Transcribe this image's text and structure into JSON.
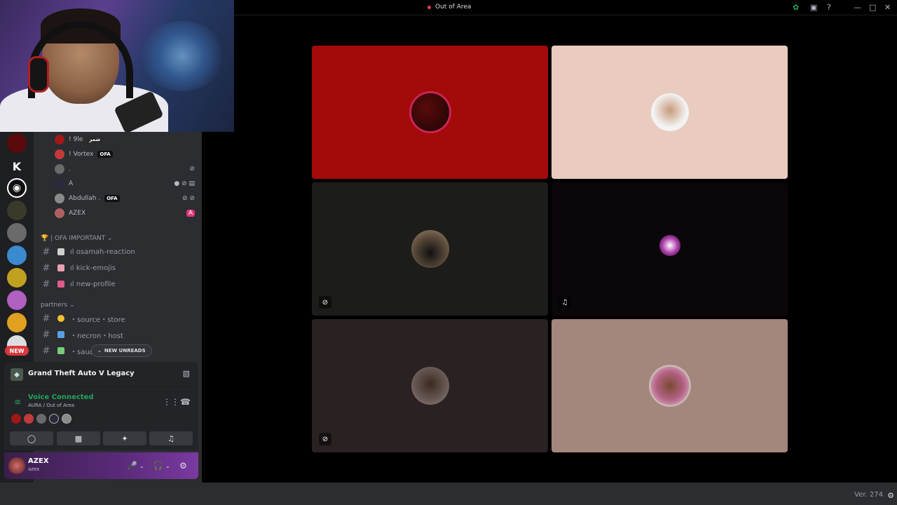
{
  "titlebar": {
    "channel_name": "Out of Area"
  },
  "rail": {
    "new_badge": "NEW"
  },
  "voice_members": [
    {
      "name": "! 9le",
      "tag": "شمر",
      "color": "#a01818"
    },
    {
      "name": "! Vortex",
      "tag": "OFA",
      "color": "#c23a3a"
    },
    {
      "name": ".",
      "tag": "",
      "color": "#6a6a6a"
    },
    {
      "name": "A",
      "tag": "",
      "color": "#2a2a3a"
    },
    {
      "name": "Abdullah .",
      "tag": "OFA",
      "color": "#8a8a8a"
    },
    {
      "name": "AZEX",
      "tag": "",
      "color": "#b06060"
    }
  ],
  "categories": {
    "important": "| OFA IMPORTANT",
    "partners": "partners"
  },
  "channels": [
    {
      "name": "ıl osamah-reaction",
      "color": "#cfcfcf"
    },
    {
      "name": "ıl kick-emojis",
      "color": "#e9a0b0"
    },
    {
      "name": "ıl new-profile",
      "color": "#e05a8a"
    },
    {
      "name": "・source・store",
      "color": "#f0c030"
    },
    {
      "name": "・necron・host",
      "color": "#5aa0e0"
    },
    {
      "name": "・saud",
      "color": "#7acb7a"
    }
  ],
  "new_unreads": "NEW UNREADS",
  "activity": {
    "game_title": "Grand Theft Auto V Legacy"
  },
  "voice_panel": {
    "status": "Voice Connected",
    "location": "AURA / Out of Area"
  },
  "user": {
    "name": "AZEX",
    "status": "azex"
  },
  "tiles": [
    {
      "bg": "#a30a0a",
      "avatar": "#1a0505",
      "muted": false
    },
    {
      "bg": "#e9cbbf",
      "avatar": "#f3f3f3",
      "muted": false
    },
    {
      "bg": "#1c1c1a",
      "avatar": "#5a4a3a",
      "muted": true
    },
    {
      "bg": "#0b060a",
      "avatar": "#3a1a3a",
      "muted": true
    },
    {
      "bg": "#2a2122",
      "avatar": "#6a5a55",
      "muted": true
    },
    {
      "bg": "#a3867c",
      "avatar": "#b06080",
      "muted": false
    }
  ],
  "footer": {
    "version": "Ver. 274"
  },
  "colors": {
    "accent_green": "#23a55a",
    "danger_red": "#da373c"
  }
}
